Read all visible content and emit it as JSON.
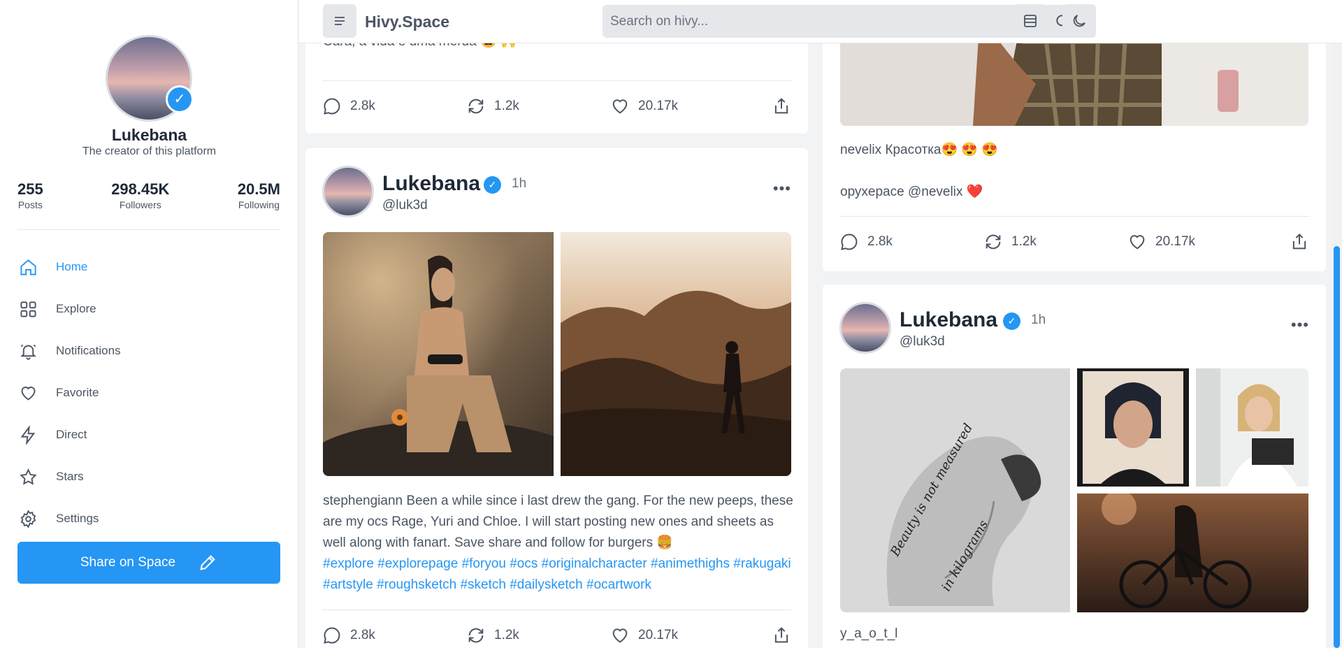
{
  "app": {
    "brand": "Hivy.Space"
  },
  "search": {
    "placeholder": "Search on hivy..."
  },
  "profile": {
    "name": "Lukebana",
    "subtitle": "The creator of this platform",
    "stats": [
      {
        "value": "255",
        "label": "Posts"
      },
      {
        "value": "298.45K",
        "label": "Followers"
      },
      {
        "value": "20.5M",
        "label": "Following"
      }
    ]
  },
  "nav": [
    {
      "label": "Home",
      "icon": "home-icon",
      "active": true
    },
    {
      "label": "Explore",
      "icon": "grid-icon"
    },
    {
      "label": "Notifications",
      "icon": "bell-icon"
    },
    {
      "label": "Favorite",
      "icon": "heart-icon"
    },
    {
      "label": "Direct",
      "icon": "lightning-icon"
    },
    {
      "label": "Stars",
      "icon": "star-icon"
    },
    {
      "label": "Settings",
      "icon": "gear-icon"
    }
  ],
  "share_button": {
    "label": "Share on Space"
  },
  "colors": {
    "accent": "#2596f3",
    "text": "#1f2937",
    "muted": "#4b5563",
    "background": "#f2f3f5"
  },
  "posts": {
    "top_left": {
      "text_fragment": "Cara, a vida é uma merda 😅 🙌",
      "comments": "2.8k",
      "reposts": "1.2k",
      "likes": "20.17k"
    },
    "main_left": {
      "author": "Lukebana",
      "time": "1h",
      "handle": "@luk3d",
      "text": "stephengiann Been a while since i last drew the gang. For the new peeps, these are my ocs Rage, Yuri and Chloe. I will start posting new ones and sheets as well along with fanart. Save share and follow for burgers 🍔",
      "hashtags": "#explore #explorepage #foryou #ocs #originalcharacter #animethighs #rakugaki #artstyle #roughsketch #sketch #dailysketch #ocartwork",
      "comments": "2.8k",
      "reposts": "1.2k",
      "likes": "20.17k"
    },
    "top_right": {
      "line1": "nevelix Красотка😍 😍 😍",
      "line2": "оруxерасе @nevelix ❤️",
      "comments": "2.8k",
      "reposts": "1.2k",
      "likes": "20.17k"
    },
    "main_right": {
      "author": "Lukebana",
      "time": "1h",
      "handle": "@luk3d",
      "photo_text_1": "Beauty is not measured",
      "photo_text_2": "in kilograms",
      "caption": "y_a_o_t_l"
    }
  }
}
